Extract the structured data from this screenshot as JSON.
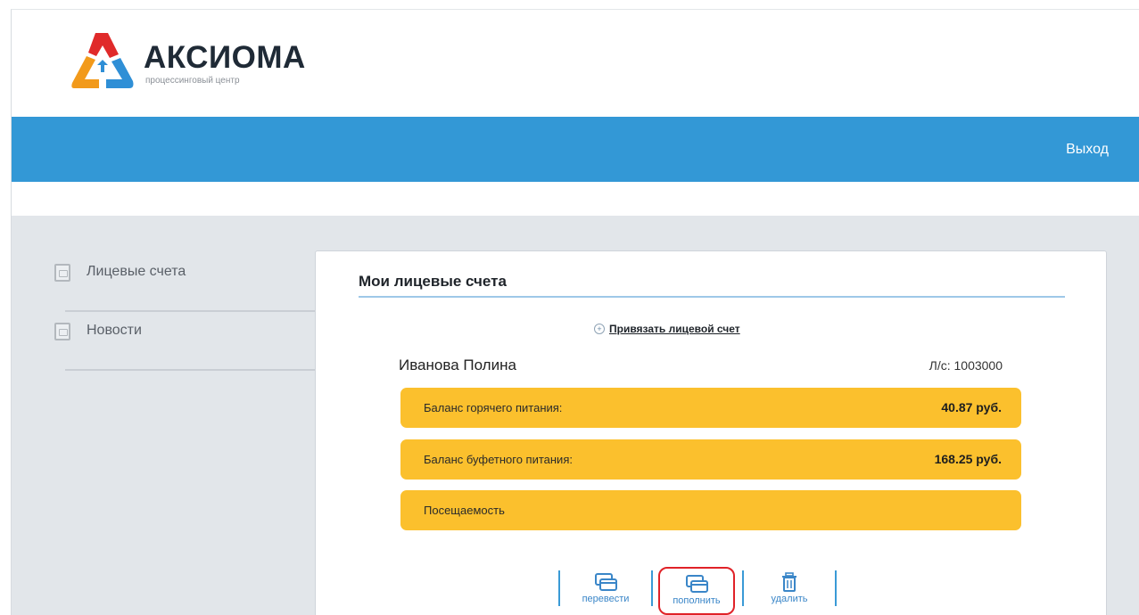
{
  "brand": {
    "name": "АКСИОМА",
    "tagline": "процессинговый центр"
  },
  "topbar": {
    "logout_label": "Выход"
  },
  "sidebar": {
    "items": [
      {
        "label": "Лицевые счета",
        "icon": "document-icon"
      },
      {
        "label": "Новости",
        "icon": "document-icon"
      }
    ]
  },
  "panel": {
    "title": "Мои лицевые счета",
    "bind_link": "Привязать лицевой счет",
    "holder_name": "Иванова Полина",
    "account_number": "Л/с: 1003000",
    "bars": [
      {
        "label": "Баланс горячего питания:",
        "value": "40.87 руб."
      },
      {
        "label": "Баланс буфетного питания:",
        "value": "168.25 руб."
      },
      {
        "label": "Посещаемость",
        "value": ""
      }
    ],
    "actions": [
      {
        "label": "перевести",
        "icon": "card-transfer-icon"
      },
      {
        "label": "пополнить",
        "icon": "card-topup-icon"
      },
      {
        "label": "удалить",
        "icon": "trash-icon"
      }
    ]
  },
  "colors": {
    "topbar": "#3398d6",
    "bar": "#fbc02d",
    "highlight": "#e02228",
    "accent": "#3a86c8"
  }
}
